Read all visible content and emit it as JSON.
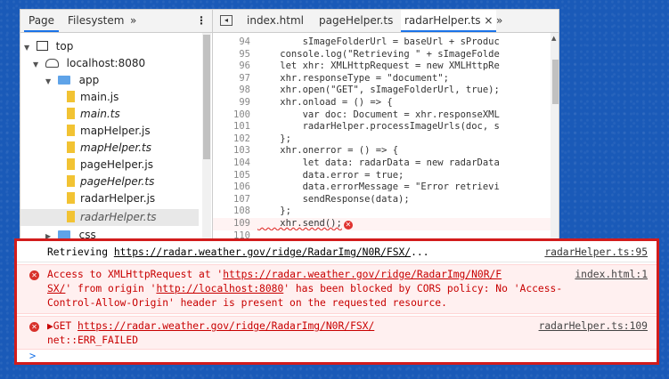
{
  "navigator": {
    "tabs": [
      "Page",
      "Filesystem"
    ],
    "more_label": "»",
    "tree": [
      {
        "label": "top",
        "kind": "frame"
      },
      {
        "label": "localhost:8080",
        "kind": "cloud"
      },
      {
        "label": "app",
        "kind": "folder"
      },
      {
        "label": "main.js",
        "kind": "file"
      },
      {
        "label": "main.ts",
        "kind": "file",
        "italic": true
      },
      {
        "label": "mapHelper.js",
        "kind": "file"
      },
      {
        "label": "mapHelper.ts",
        "kind": "file",
        "italic": true
      },
      {
        "label": "pageHelper.js",
        "kind": "file"
      },
      {
        "label": "pageHelper.ts",
        "kind": "file",
        "italic": true
      },
      {
        "label": "radarHelper.js",
        "kind": "file"
      },
      {
        "label": "radarHelper.ts",
        "kind": "file",
        "italic": true,
        "selected": true
      },
      {
        "label": "css",
        "kind": "folder"
      }
    ]
  },
  "editor": {
    "tabs": [
      "index.html",
      "pageHelper.ts",
      "radarHelper.ts"
    ],
    "close_glyph": "×",
    "more_label": "»",
    "lines": [
      {
        "n": "94",
        "code": "        sImageFolderUrl = baseUrl + sProduc"
      },
      {
        "n": "95",
        "code": "    console.log(\"Retrieving \" + sImageFolde"
      },
      {
        "n": "96",
        "code": "    let xhr: XMLHttpRequest = new XMLHttpRe"
      },
      {
        "n": "97",
        "code": "    xhr.responseType = \"document\";"
      },
      {
        "n": "98",
        "code": "    xhr.open(\"GET\", sImageFolderUrl, true);"
      },
      {
        "n": "99",
        "code": "    xhr.onload = () => {"
      },
      {
        "n": "100",
        "code": "        var doc: Document = xhr.responseXML"
      },
      {
        "n": "101",
        "code": "        radarHelper.processImageUrls(doc, s"
      },
      {
        "n": "102",
        "code": "    };"
      },
      {
        "n": "103",
        "code": "    xhr.onerror = () => {"
      },
      {
        "n": "104",
        "code": "        let data: radarData = new radarData"
      },
      {
        "n": "105",
        "code": "        data.error = true;"
      },
      {
        "n": "106",
        "code": "        data.errorMessage = \"Error retrievi"
      },
      {
        "n": "107",
        "code": "        sendResponse(data);"
      },
      {
        "n": "108",
        "code": "    };"
      },
      {
        "n": "109",
        "code": "    xhr.send();"
      },
      {
        "n": "110",
        "code": ""
      }
    ]
  },
  "console": {
    "log1": {
      "prefix": "Retrieving ",
      "url": "https://radar.weather.gov/ridge/RadarImg/N0R/FSX/",
      "suffix": "...",
      "source": "radarHelper.ts:95"
    },
    "error1": {
      "l1_a": "Access to XMLHttpRequest at '",
      "l1_url": "https://radar.weather.gov/ridge/RadarImg/N0R/F",
      "source": "index.html:1",
      "l2_url": "SX/",
      "l2_b": "' from origin '",
      "l2_origin": "http://localhost:8080",
      "l2_c": "' has been blocked by CORS policy: No 'Access-",
      "l3": "Control-Allow-Origin' header is present on the requested resource."
    },
    "error2": {
      "prefix": "▶GET ",
      "url": "https://radar.weather.gov/ridge/RadarImg/N0R/FSX/",
      "source": "radarHelper.ts:109",
      "l2": "net::ERR_FAILED"
    },
    "prompt": ">"
  }
}
